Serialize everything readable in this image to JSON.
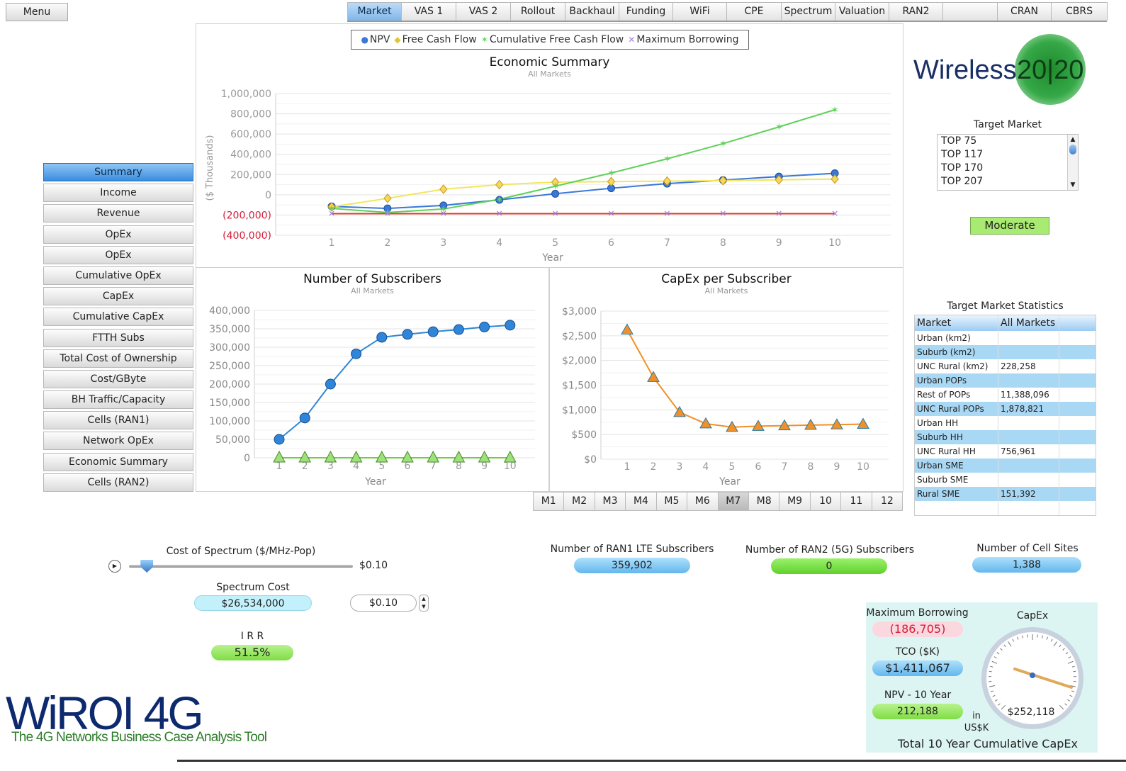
{
  "menu_label": "Menu",
  "top_tabs": [
    {
      "label": "Market",
      "active": true
    },
    {
      "label": "VAS 1"
    },
    {
      "label": "VAS 2"
    },
    {
      "label": "Rollout"
    },
    {
      "label": "Backhaul"
    },
    {
      "label": "Funding"
    },
    {
      "label": "WiFi"
    },
    {
      "label": "CPE"
    },
    {
      "label": "Spectrum"
    },
    {
      "label": "Valuation"
    },
    {
      "label": "RAN2"
    },
    {
      "label": ""
    },
    {
      "label": "CRAN"
    },
    {
      "label": "CBRS"
    }
  ],
  "left_nav": [
    {
      "label": "Summary",
      "active": true
    },
    {
      "label": "Income"
    },
    {
      "label": "Revenue"
    },
    {
      "label": "OpEx"
    },
    {
      "label": "OpEx"
    },
    {
      "label": "Cumulative OpEx"
    },
    {
      "label": "CapEx"
    },
    {
      "label": "Cumulative CapEx"
    },
    {
      "label": "FTTH Subs"
    },
    {
      "label": "Total Cost of Ownership"
    },
    {
      "label": "Cost/GByte"
    },
    {
      "label": "BH Traffic/Capacity"
    },
    {
      "label": "Cells (RAN1)"
    },
    {
      "label": "Network OpEx"
    },
    {
      "label": "Economic Summary"
    },
    {
      "label": "Cells (RAN2)"
    }
  ],
  "economic_summary": {
    "title": "Economic Summary",
    "subtitle": "All Markets",
    "ylabel": "($ Thousands)",
    "xlabel": "Year",
    "legend": [
      "NPV",
      "Free Cash Flow",
      "Cumulative Free Cash Flow",
      "Maximum Borrowing"
    ],
    "y_ticks": [
      "1,000,000",
      "800,000",
      "600,000",
      "400,000",
      "200,000",
      "0",
      "(200,000)",
      "(400,000)"
    ],
    "x_ticks": [
      "1",
      "2",
      "3",
      "4",
      "5",
      "6",
      "7",
      "8",
      "9",
      "10"
    ]
  },
  "subscribers_chart": {
    "title": "Number of Subscribers",
    "subtitle": "All Markets",
    "xlabel": "Year",
    "y_ticks": [
      "400,000",
      "350,000",
      "300,000",
      "250,000",
      "200,000",
      "150,000",
      "100,000",
      "50,000",
      "0"
    ],
    "x_ticks": [
      "1",
      "2",
      "3",
      "4",
      "5",
      "6",
      "7",
      "8",
      "9",
      "10"
    ]
  },
  "capex_chart": {
    "title": "CapEx per Subscriber",
    "subtitle": "All Markets",
    "xlabel": "Year",
    "y_ticks": [
      "$3,000",
      "$2,500",
      "$2,000",
      "$1,500",
      "$1,000",
      "$500",
      "$0"
    ],
    "x_ticks": [
      "1",
      "2",
      "3",
      "4",
      "5",
      "6",
      "7",
      "8",
      "9",
      "10"
    ]
  },
  "chart_data": [
    {
      "type": "line",
      "title": "Economic Summary",
      "subtitle": "All Markets",
      "xlabel": "Year",
      "ylabel": "($ Thousands)",
      "x": [
        1,
        2,
        3,
        4,
        5,
        6,
        7,
        8,
        9,
        10
      ],
      "ylim": [
        -400000,
        1000000
      ],
      "legend_position": "top",
      "series": [
        {
          "name": "NPV",
          "color": "#3a78d8",
          "marker": "circle",
          "values": [
            -115000,
            -135000,
            -105000,
            -50000,
            10000,
            65000,
            110000,
            145000,
            180000,
            212188
          ]
        },
        {
          "name": "Free Cash Flow",
          "color": "#f2e65c",
          "marker": "diamond",
          "values": [
            -120000,
            -35000,
            55000,
            100000,
            125000,
            130000,
            135000,
            140000,
            148000,
            155000
          ]
        },
        {
          "name": "Cumulative Free Cash Flow",
          "color": "#5fd15a",
          "marker": "star",
          "values": [
            -135000,
            -175000,
            -140000,
            -45000,
            85000,
            215000,
            355000,
            505000,
            670000,
            840000
          ]
        },
        {
          "name": "Maximum Borrowing",
          "color": "#e23b2a",
          "marker": "x",
          "values": [
            -186705,
            -186705,
            -186705,
            -186705,
            -186705,
            -186705,
            -186705,
            -186705,
            -186705,
            -186705
          ]
        }
      ]
    },
    {
      "type": "line",
      "title": "Number of Subscribers",
      "subtitle": "All Markets",
      "xlabel": "Year",
      "x": [
        1,
        2,
        3,
        4,
        5,
        6,
        7,
        8,
        9,
        10
      ],
      "ylim": [
        0,
        400000
      ],
      "series": [
        {
          "color": "#2f86d8",
          "marker": "circle",
          "values": [
            50000,
            108000,
            200000,
            282000,
            327000,
            335000,
            342000,
            348000,
            355000,
            359902
          ]
        },
        {
          "color": "#6ccf3e",
          "marker": "triangle",
          "values": [
            0,
            0,
            0,
            0,
            0,
            0,
            0,
            0,
            0,
            0
          ]
        }
      ]
    },
    {
      "type": "line",
      "title": "CapEx per Subscriber",
      "subtitle": "All Markets",
      "xlabel": "Year",
      "x": [
        1,
        2,
        3,
        4,
        5,
        6,
        7,
        8,
        9,
        10
      ],
      "ylim": [
        0,
        3000
      ],
      "series": [
        {
          "color": "#f0902a",
          "marker": "triangle",
          "values": [
            2620,
            1660,
            950,
            720,
            650,
            670,
            680,
            690,
            700,
            710
          ]
        }
      ]
    }
  ],
  "m_tabs": [
    {
      "label": "M1"
    },
    {
      "label": "M2"
    },
    {
      "label": "M3"
    },
    {
      "label": "M4"
    },
    {
      "label": "M5"
    },
    {
      "label": "M6"
    },
    {
      "label": "M7",
      "active": true
    },
    {
      "label": "M8"
    },
    {
      "label": "M9"
    },
    {
      "label": "10"
    },
    {
      "label": "11"
    },
    {
      "label": "12"
    }
  ],
  "logo": {
    "text": "Wireless",
    "number": "20|20"
  },
  "target_market": {
    "label": "Target Market",
    "options": [
      "TOP 75",
      "TOP 117",
      "TOP 170",
      "TOP 207"
    ]
  },
  "moderate_button": "Moderate",
  "stats": {
    "title": "Target Market Statistics",
    "header": [
      "Market",
      "All Markets"
    ],
    "rows": [
      [
        "Urban (km2)",
        ""
      ],
      [
        "Suburb (km2)",
        ""
      ],
      [
        "UNC Rural (km2)",
        "228,258"
      ],
      [
        "Urban POPs",
        ""
      ],
      [
        "Rest of POPs",
        "11,388,096"
      ],
      [
        "UNC Rural POPs",
        "1,878,821"
      ],
      [
        "Urban HH",
        ""
      ],
      [
        "Suburb HH",
        ""
      ],
      [
        "UNC Rural HH",
        "756,961"
      ],
      [
        "Urban SME",
        ""
      ],
      [
        "Suburb SME",
        ""
      ],
      [
        "Rural SME",
        "151,392"
      ],
      [
        "",
        ""
      ]
    ]
  },
  "spectrum": {
    "slider_label": "Cost of Spectrum ($/MHz-Pop)",
    "slider_value": "$0.10",
    "slider_position": 0.08,
    "cost_label": "Spectrum Cost",
    "cost_value": "$26,534,000",
    "stepper_value": "$0.10"
  },
  "irr": {
    "label": "I R R",
    "value": "51.5%"
  },
  "ran1_subs": {
    "label": "Number of RAN1 LTE Subscribers",
    "value": "359,902"
  },
  "ran2_subs": {
    "label": "Number of RAN2 (5G) Subscribers",
    "value": "0"
  },
  "cell_sites": {
    "label": "Number of Cell Sites",
    "value": "1,388"
  },
  "capex_panel": {
    "max_borrowing_label": "Maximum Borrowing",
    "max_borrowing_value": "(186,705)",
    "tco_label": "TCO ($K)",
    "tco_value": "$1,411,067",
    "npv_label": "NPV - 10 Year",
    "npv_value": "212,188",
    "units": "in US$K",
    "gauge_title": "CapEx",
    "gauge_value": "$252,118",
    "footer": "Total 10 Year Cumulative CapEx"
  },
  "product_logo": {
    "main": "WiROI 4G",
    "tagline": "The 4G Networks Business Case Analysis Tool"
  },
  "colors": {
    "accent_blue": "#3a8de0",
    "green": "#5fd12c",
    "negative_red": "#d21d37"
  }
}
